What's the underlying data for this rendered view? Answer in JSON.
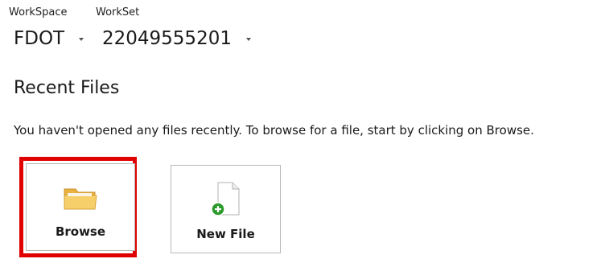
{
  "workspace": {
    "label": "WorkSpace",
    "value": "FDOT"
  },
  "workset": {
    "label": "WorkSet",
    "value": "22049555201"
  },
  "recent": {
    "title": "Recent Files",
    "message": "You haven't opened any files recently.  To browse for a file, start by clicking on Browse."
  },
  "tiles": {
    "browse": {
      "label": "Browse",
      "icon": "folder-icon"
    },
    "new_file": {
      "label": "New File",
      "icon": "new-file-icon"
    }
  },
  "colors": {
    "highlight": "#e00000",
    "folder": "#f3c65a",
    "add_badge": "#2a9a2a"
  }
}
